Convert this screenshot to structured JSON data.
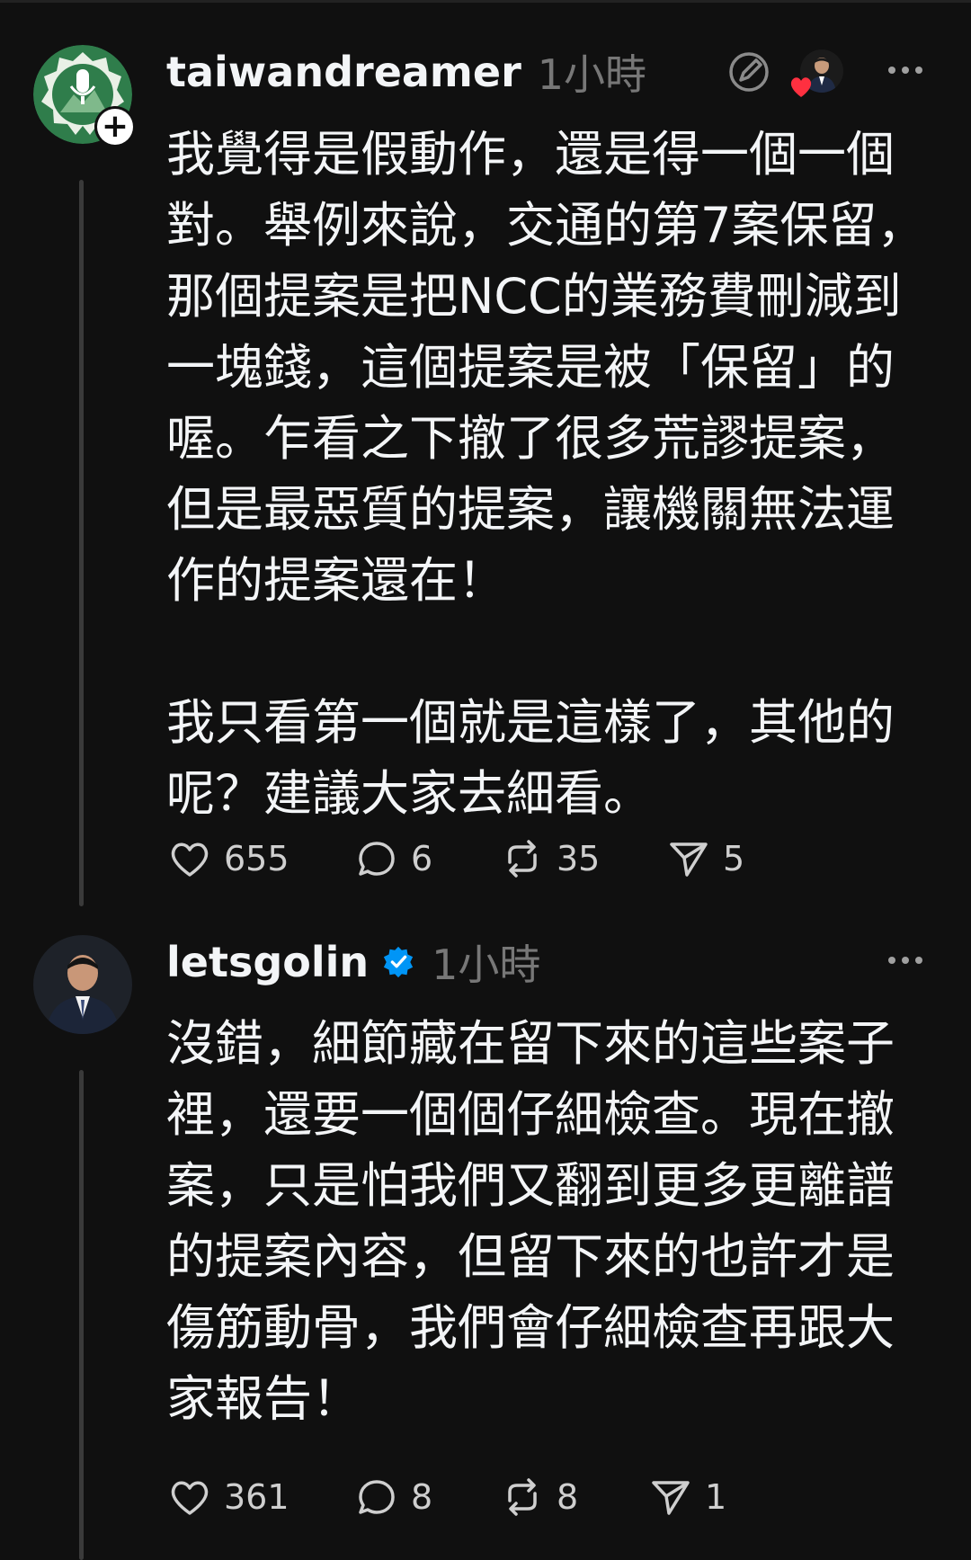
{
  "posts": [
    {
      "username": "taiwandreamer",
      "timestamp": "1小時",
      "body": "我覺得是假動作，還是得一個一個\n對。舉例來說，交通的第7案保留，\n那個提案是把NCC的業務費刪減到\n一塊錢，這個提案是被「保留」的\n喔。乍看之下撤了很多荒謬提案，\n但是最惡質的提案，讓機關無法運\n作的提案還在！\n\n我只看第一個就是這樣了，其他的\n呢？建議大家去細看。",
      "likes": "655",
      "replies": "6",
      "reposts": "35",
      "shares": "5"
    },
    {
      "username": "letsgolin",
      "timestamp": "1小時",
      "body": "沒錯，細節藏在留下來的這些案子\n裡，還要一個個仔細檢查。現在撤\n案，只是怕我們又翻到更多更離譜\n的提案內容，但留下來的也許才是\n傷筋動骨，我們會仔細檢查再跟大\n家報告！",
      "likes": "361",
      "replies": "8",
      "reposts": "8",
      "shares": "1"
    }
  ],
  "icons": {
    "verified": "verified-badge-icon",
    "follow": "plus-icon",
    "more": "more-horizontal-icon",
    "like": "heart-icon",
    "reply": "comment-icon",
    "repost": "repost-icon",
    "share": "send-icon",
    "quote": "quote-edit-icon",
    "liked_by": "heart-icon"
  },
  "colors": {
    "background": "#101010",
    "text": "#f3f5f7",
    "muted": "#777777",
    "verified": "#0095f6",
    "heart": "#ff3040"
  }
}
